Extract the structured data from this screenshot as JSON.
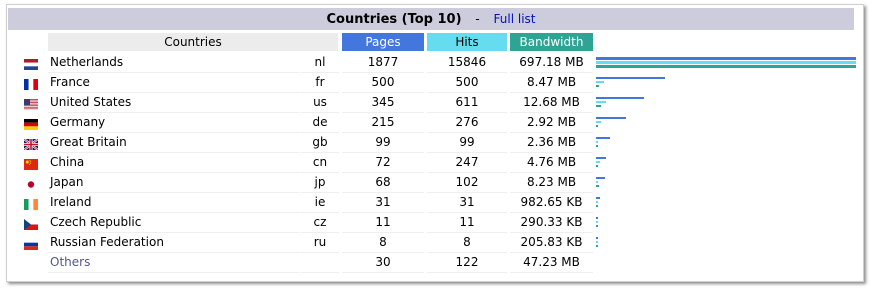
{
  "header": {
    "title": "Countries (Top 10)",
    "separator": "-",
    "full_list_link": "Full list"
  },
  "columns": {
    "countries": "Countries",
    "pages": "Pages",
    "hits": "Hits",
    "bandwidth": "Bandwidth"
  },
  "colors": {
    "pages_bar": "#4477dd",
    "hits_bar": "#66ddee",
    "bandwidth_bar": "#2ea495",
    "title_bg": "#ccccdd"
  },
  "rows": [
    {
      "name": "Netherlands",
      "code": "nl",
      "flag": "flag-nl-icon",
      "pages": "1877",
      "hits": "15846",
      "bandwidth": "697.18 MB"
    },
    {
      "name": "France",
      "code": "fr",
      "flag": "flag-fr-icon",
      "pages": "500",
      "hits": "500",
      "bandwidth": "8.47 MB"
    },
    {
      "name": "United States",
      "code": "us",
      "flag": "flag-us-icon",
      "pages": "345",
      "hits": "611",
      "bandwidth": "12.68 MB"
    },
    {
      "name": "Germany",
      "code": "de",
      "flag": "flag-de-icon",
      "pages": "215",
      "hits": "276",
      "bandwidth": "2.92 MB"
    },
    {
      "name": "Great Britain",
      "code": "gb",
      "flag": "flag-gb-icon",
      "pages": "99",
      "hits": "99",
      "bandwidth": "2.36 MB"
    },
    {
      "name": "China",
      "code": "cn",
      "flag": "flag-cn-icon",
      "pages": "72",
      "hits": "247",
      "bandwidth": "4.76 MB"
    },
    {
      "name": "Japan",
      "code": "jp",
      "flag": "flag-jp-icon",
      "pages": "68",
      "hits": "102",
      "bandwidth": "8.23 MB"
    },
    {
      "name": "Ireland",
      "code": "ie",
      "flag": "flag-ie-icon",
      "pages": "31",
      "hits": "31",
      "bandwidth": "982.65 KB"
    },
    {
      "name": "Czech Republic",
      "code": "cz",
      "flag": "flag-cz-icon",
      "pages": "11",
      "hits": "11",
      "bandwidth": "290.33 KB"
    },
    {
      "name": "Russian Federation",
      "code": "ru",
      "flag": "flag-ru-icon",
      "pages": "8",
      "hits": "8",
      "bandwidth": "205.83 KB"
    }
  ],
  "others": {
    "name": "Others",
    "pages": "30",
    "hits": "122",
    "bandwidth": "47.23 MB"
  }
}
